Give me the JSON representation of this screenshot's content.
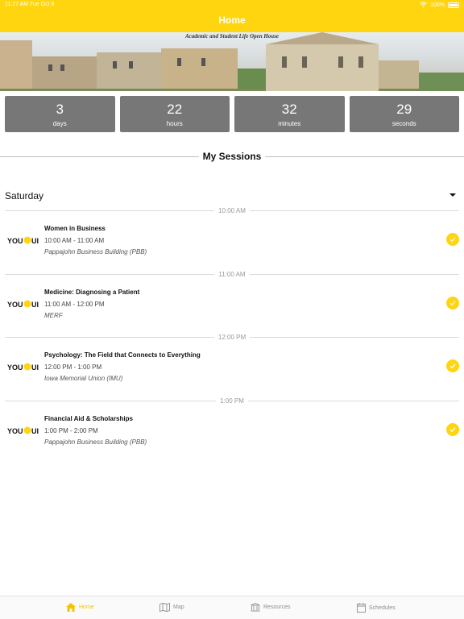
{
  "status_bar": {
    "time": "11:27 AM  Tue Oct 8",
    "battery": "100%"
  },
  "header": {
    "title": "Home"
  },
  "banner": {
    "caption": "Academic and Student Life Open House"
  },
  "countdown": [
    {
      "value": "3",
      "label": "days"
    },
    {
      "value": "22",
      "label": "hours"
    },
    {
      "value": "32",
      "label": "minutes"
    },
    {
      "value": "29",
      "label": "seconds"
    }
  ],
  "section": {
    "title": "My Sessions"
  },
  "day": {
    "label": "Saturday"
  },
  "sessions": [
    {
      "slot": "10:00 AM",
      "title": "Women in Business",
      "time": "10:00 AM - 11:00 AM",
      "place": "Pappajohn Business Building (PBB)"
    },
    {
      "slot": "11:00 AM",
      "title": "Medicine: Diagnosing a Patient",
      "time": "11:00 AM - 12:00 PM",
      "place": "MERF"
    },
    {
      "slot": "12:00 PM",
      "title": "Psychology: The Field that Connects to Everything",
      "time": "12:00 PM - 1:00 PM",
      "place": "Iowa Memorial Union (IMU)"
    },
    {
      "slot": "1:00 PM",
      "title": "Financial Aid & Scholarships",
      "time": "1:00 PM - 2:00 PM",
      "place": "Pappajohn Business Building (PBB)"
    }
  ],
  "logo_text": "YOU IOWA UI",
  "tabs": [
    {
      "label": "Home",
      "icon": "home-icon",
      "active": true
    },
    {
      "label": "Map",
      "icon": "map-icon",
      "active": false
    },
    {
      "label": "Resources",
      "icon": "resources-icon",
      "active": false
    },
    {
      "label": "Schedules",
      "icon": "schedules-icon",
      "active": false
    }
  ],
  "colors": {
    "brand": "#FFD50F",
    "countdown_bg": "#777777",
    "muted": "#999999"
  }
}
